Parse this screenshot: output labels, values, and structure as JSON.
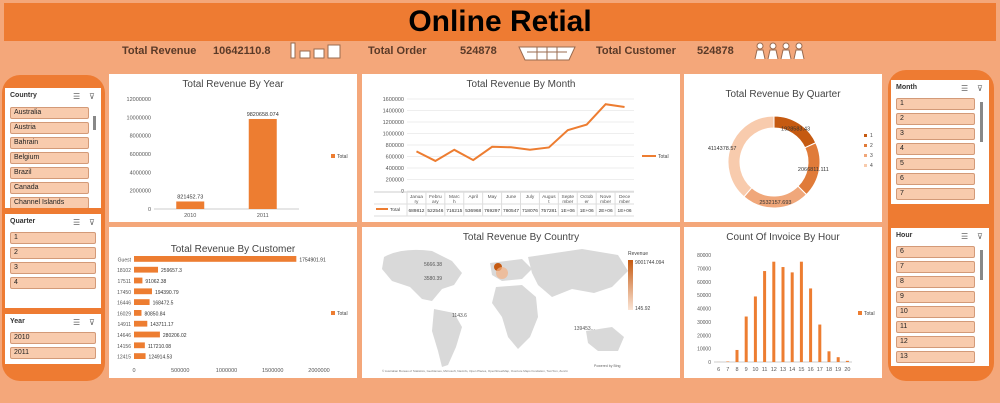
{
  "header": {
    "title": "Online Retial"
  },
  "kpis": {
    "revenue_label": "Total Revenue",
    "revenue_value": "10642110.8",
    "order_label": "Total Order",
    "order_value": "524878",
    "customer_label": "Total Customer",
    "customer_value": "524878"
  },
  "colors": {
    "accent": "#ed7d31",
    "dark": "#c55a11",
    "light": "#f8cbad",
    "page": "#f4a77a"
  },
  "slicers": {
    "country": {
      "title": "Country",
      "items": [
        "Australia",
        "Austria",
        "Bahrain",
        "Belgium",
        "Brazil",
        "Canada",
        "Channel Islands"
      ]
    },
    "quarter": {
      "title": "Quarter",
      "items": [
        "1",
        "2",
        "3",
        "4"
      ]
    },
    "year": {
      "title": "Year",
      "items": [
        "2010",
        "2011"
      ]
    },
    "month": {
      "title": "Month",
      "items": [
        "1",
        "2",
        "3",
        "4",
        "5",
        "6",
        "7"
      ]
    },
    "hour": {
      "title": "Hour",
      "items": [
        "6",
        "7",
        "8",
        "9",
        "10",
        "11",
        "12",
        "13"
      ]
    }
  },
  "chart_data": [
    {
      "type": "bar",
      "title": "Total Revenue By Year",
      "categories": [
        "2010",
        "2011"
      ],
      "series": [
        {
          "name": "Total",
          "values": [
            821452.73,
            9820658.074
          ]
        }
      ],
      "data_labels": [
        "821452.73",
        "9820658.074"
      ],
      "ylim": [
        0,
        12000000
      ],
      "yticks": [
        "0",
        "2000000",
        "4000000",
        "6000000",
        "8000000",
        "10000000",
        "12000000"
      ],
      "legend": "right"
    },
    {
      "type": "line",
      "title": "Total Revenue By Month",
      "categories": [
        "January",
        "February",
        "March",
        "April",
        "May",
        "June",
        "July",
        "August",
        "September",
        "October",
        "November",
        "December"
      ],
      "category_labels": [
        "Janua ry",
        "Febru ary",
        "Marc h",
        "April",
        "May",
        "June",
        "July",
        "Augus t",
        "Septe mber",
        "Octob er",
        "Nove mber",
        "Dece mber"
      ],
      "table_values": [
        "689812",
        "522546",
        "716215",
        "536968",
        "769297",
        "780547",
        "718076",
        "757281",
        "1E+06",
        "1E+06",
        "2E+06",
        "1E+06"
      ],
      "series": [
        {
          "name": "Total",
          "values": [
            689812,
            522546,
            716215,
            536968,
            769297,
            760547,
            718076,
            757281,
            1058000,
            1155000,
            1509000,
            1461000
          ]
        }
      ],
      "ylim": [
        0,
        1600000
      ],
      "yticks": [
        "0",
        "200000",
        "400000",
        "600000",
        "800000",
        "1000000",
        "1200000",
        "1400000",
        "1600000"
      ],
      "legend": "right"
    },
    {
      "type": "pie",
      "title": "Total Revenue By Quarter",
      "categories": [
        "1",
        "2",
        "3",
        "4"
      ],
      "values": [
        1928583.43,
        2066811.111,
        2532157.693,
        4114378.57
      ],
      "data_labels": [
        "1928583.43",
        "2066811.111",
        "2532157.693",
        "4114378.57"
      ],
      "legend": "right"
    },
    {
      "type": "bar",
      "orientation": "horizontal",
      "title": "Total Revenue By Customer",
      "categories": [
        "Guest",
        "18102",
        "17511",
        "17450",
        "16446",
        "16029",
        "14911",
        "14646",
        "14156",
        "12415"
      ],
      "series": [
        {
          "name": "Total",
          "values": [
            1754901.91,
            259657.3,
            91062.38,
            194390.79,
            168472.5,
            80850.84,
            143711.17,
            280206.02,
            117210.08,
            124914.53
          ]
        }
      ],
      "data_labels": [
        "1754901.91",
        "259657.3",
        "91062.38",
        "194390.79",
        "168472.5",
        "80850.84",
        "143711.17",
        "280206.02",
        "117210.08",
        "124914.53"
      ],
      "xlim": [
        0,
        2000000
      ],
      "xticks": [
        "0",
        "500000",
        "1000000",
        "1500000",
        "2000000"
      ],
      "legend": "right"
    },
    {
      "type": "map",
      "title": "Total Revenue By Country",
      "legend_title": "Revenue",
      "legend_max": "9001744.094",
      "legend_min": "145.92",
      "labels": [
        "5666.38",
        "3580.39",
        "1143.6",
        "139453..."
      ],
      "attribution": "Powered by Bing",
      "footer": "© Australian Bureau of Statistics, GeoNames, Microsoft, Navinfo, Open Places, OpenStreetMap, Overture Maps Fundation, TomTom, Zenrin"
    },
    {
      "type": "bar",
      "title": "Count Of Invoice By Hour",
      "categories": [
        "6",
        "7",
        "8",
        "9",
        "10",
        "11",
        "12",
        "13",
        "14",
        "15",
        "16",
        "17",
        "18",
        "19",
        "20"
      ],
      "series": [
        {
          "name": "Total",
          "values": [
            40,
            380,
            9000,
            34000,
            49000,
            68000,
            75000,
            71000,
            67000,
            75000,
            55000,
            28000,
            8000,
            3600,
            870
          ]
        }
      ],
      "ylim": [
        0,
        80000
      ],
      "yticks": [
        "0",
        "10000",
        "20000",
        "30000",
        "40000",
        "50000",
        "60000",
        "70000",
        "80000"
      ],
      "legend": "right"
    }
  ]
}
